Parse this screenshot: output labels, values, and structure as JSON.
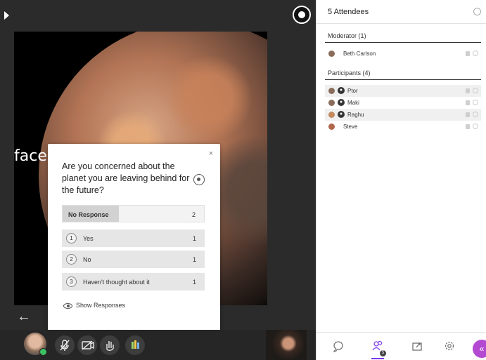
{
  "slide": {
    "partial_text": "face"
  },
  "poll": {
    "question": "Are you concerned about the planet you are leaving behind for the future?",
    "close_glyph": "×",
    "no_response": {
      "label": "No Response",
      "count": "2",
      "fraction": 0.4
    },
    "options": [
      {
        "num": "1",
        "label": "Yes",
        "count": "1"
      },
      {
        "num": "2",
        "label": "No",
        "count": "1"
      },
      {
        "num": "3",
        "label": "Haven't thought about it",
        "count": "1"
      }
    ],
    "show_responses": "Show Responses"
  },
  "panel": {
    "title": "5 Attendees",
    "moderator_heading": "Moderator (1)",
    "moderators": [
      {
        "name": "Beth Carlson"
      }
    ],
    "participants_heading": "Participants (4)",
    "participants": [
      {
        "name": "Ptor",
        "badge": "●"
      },
      {
        "name": "Maki",
        "badge": "●"
      },
      {
        "name": "Raghu",
        "badge": "●"
      },
      {
        "name": "Steve",
        "badge": ""
      }
    ],
    "attendees_badge": "5"
  },
  "controls": {
    "back_glyph": "←"
  },
  "colors": {
    "accent": "#b44ad1",
    "tab_underline": "#7c3aed",
    "status_online": "#3cc163"
  },
  "icons": [
    "record-icon",
    "microphone-icon",
    "camera-icon",
    "raise-hand-icon",
    "share-icon",
    "chat-icon",
    "attendees-icon",
    "settings-icon"
  ]
}
